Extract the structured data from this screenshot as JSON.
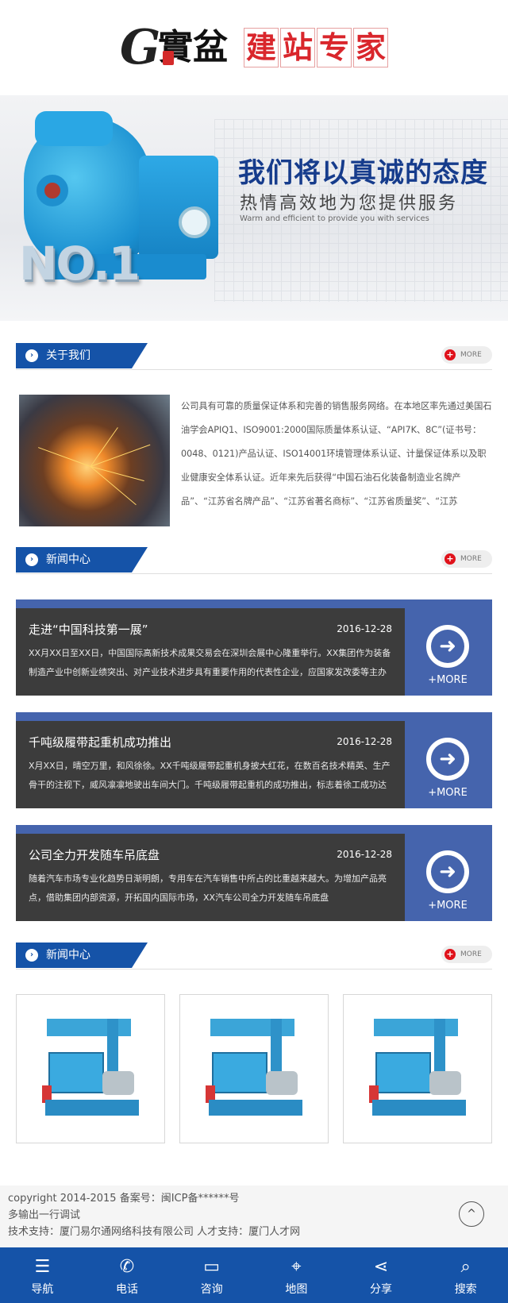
{
  "header": {
    "logo_mark_g": "G",
    "logo_mark_cn": "實盆",
    "logo_text": [
      "建",
      "站",
      "专",
      "家"
    ]
  },
  "banner": {
    "badge": "NO.1",
    "title": "我们将以真诚的态度",
    "subtitle": "热情高效地为您提供服务",
    "subtitle_en": "Warm and efficient to provide you with services"
  },
  "sections": {
    "about": {
      "title": "关于我们",
      "more": "MORE"
    },
    "news": {
      "title": "新闻中心",
      "more": "MORE"
    },
    "products": {
      "title": "新闻中心",
      "more": "MORE"
    }
  },
  "about": {
    "text": "公司具有可靠的质量保证体系和完善的销售服务网络。在本地区率先通过美国石油学会APIQ1、ISO9001:2000国际质量体系认证、“API7K、8C”(证书号：0048、0121)产品认证、ISO14001环境管理体系认证、计量保证体系以及职业健康安全体系认证。近年来先后获得“中国石油石化装备制造业名牌产品”、“江苏省名牌产品”、“江苏省著名商标”、“江苏省质量奖”、“江苏"
  },
  "news": [
    {
      "title": "走进“中国科技第一展”",
      "date": "2016-12-28",
      "desc": "XX月XX日至XX日，中国国际高新技术成果交易会在深圳会展中心隆重举行。XX集团作为装备制造产业中创新业绩突出、对产业技术进步具有重要作用的代表性企业，应国家发改委等主办方邀",
      "more": "+MORE"
    },
    {
      "title": "千吨级履带起重机成功推出",
      "date": "2016-12-28",
      "desc": "X月XX日，晴空万里，和风徐徐。XX千吨级履带起重机身披大红花，在数百名技术精英、生产骨干的注视下，威风凛凛地驶出车间大门。千吨级履带起重机的成功推出，标志着徐工成功达到超",
      "more": "+MORE"
    },
    {
      "title": "公司全力开发随车吊底盘",
      "date": "2016-12-28",
      "desc": "随着汽车市场专业化趋势日渐明朗，专用车在汽车销售中所占的比重越来越大。为增加产品亮点，借助集团内部资源，开拓国内国际市场，XX汽车公司全力开发随车吊底盘",
      "more": "+MORE"
    }
  ],
  "footer": {
    "line1": "copyright 2014-2015 备案号：闽ICP备******号",
    "line2": "多输出一行调试",
    "line3": "技术支持：厦门易尔通网络科技有限公司 人才支持：厦门人才网",
    "top_icon": "^"
  },
  "bottom_nav": [
    {
      "label": "导航",
      "icon": "menu-icon"
    },
    {
      "label": "电话",
      "icon": "phone-icon"
    },
    {
      "label": "咨询",
      "icon": "chat-icon"
    },
    {
      "label": "地图",
      "icon": "map-icon"
    },
    {
      "label": "分享",
      "icon": "share-icon"
    },
    {
      "label": "搜索",
      "icon": "search-icon"
    }
  ],
  "colors": {
    "primary": "#1553a8",
    "news_accent": "#4564ad",
    "news_body": "#3c3c3c",
    "logo_red": "#d9262c",
    "more_dot": "#e0121b"
  }
}
